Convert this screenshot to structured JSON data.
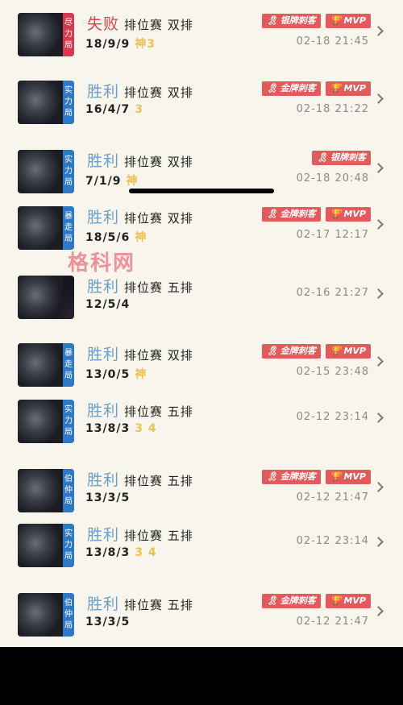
{
  "watermark": "格科网",
  "matches": [
    {
      "mode": "尽力局",
      "mode_color": "red",
      "result": "失败",
      "result_type": "lose",
      "type": "排位赛 双排",
      "kda": "18/9/9",
      "medals": "神3",
      "badges": [
        "银牌刺客",
        "MVP"
      ],
      "time": "02-18 21:45"
    },
    {
      "mode": "实力局",
      "mode_color": "blue",
      "result": "胜利",
      "result_type": "win",
      "type": "排位赛 双排",
      "kda": "16/4/7",
      "medals": "3",
      "badges": [
        "金牌刺客",
        "MVP"
      ],
      "time": "02-18 21:22"
    },
    {
      "mode": "实力局",
      "mode_color": "blue",
      "result": "胜利",
      "result_type": "win",
      "type": "排位赛 双排",
      "kda": "7/1/9",
      "medals": "神",
      "badges": [
        "银牌刺客"
      ],
      "time": "02-18 20:48"
    },
    {
      "mode": "暴走局",
      "mode_color": "blue",
      "result": "胜利",
      "result_type": "win",
      "type": "排位赛 双排",
      "kda": "18/5/6",
      "medals": "神",
      "badges": [
        "金牌刺客",
        "MVP"
      ],
      "time": "02-17 12:17"
    },
    {
      "mode": "",
      "mode_color": "none",
      "result": "胜利",
      "result_type": "win",
      "type": "排位赛 五排",
      "kda": "12/5/4",
      "medals": "",
      "badges": [],
      "time": "02-16 21:27"
    },
    {
      "mode": "暴走局",
      "mode_color": "blue",
      "result": "胜利",
      "result_type": "win",
      "type": "排位赛 双排",
      "kda": "13/0/5",
      "medals": "神",
      "badges": [
        "金牌刺客",
        "MVP"
      ],
      "time": "02-15 23:48"
    },
    {
      "mode": "实力局",
      "mode_color": "blue",
      "result": "胜利",
      "result_type": "win",
      "type": "排位赛 五排",
      "kda": "13/8/3",
      "medals": "3 4",
      "badges": [],
      "time": "02-12 23:14"
    },
    {
      "mode": "伯仲局",
      "mode_color": "blue",
      "result": "胜利",
      "result_type": "win",
      "type": "排位赛 五排",
      "kda": "13/3/5",
      "medals": "",
      "badges": [
        "金牌刺客",
        "MVP"
      ],
      "time": "02-12 21:47"
    },
    {
      "mode": "实力局",
      "mode_color": "blue",
      "result": "胜利",
      "result_type": "win",
      "type": "排位赛 五排",
      "kda": "13/8/3",
      "medals": "3 4",
      "badges": [],
      "time": "02-12 23:14"
    },
    {
      "mode": "伯仲局",
      "mode_color": "blue",
      "result": "胜利",
      "result_type": "win",
      "type": "排位赛 五排",
      "kda": "13/3/5",
      "medals": "",
      "badges": [
        "金牌刺客",
        "MVP"
      ],
      "time": "02-12 21:47"
    }
  ]
}
